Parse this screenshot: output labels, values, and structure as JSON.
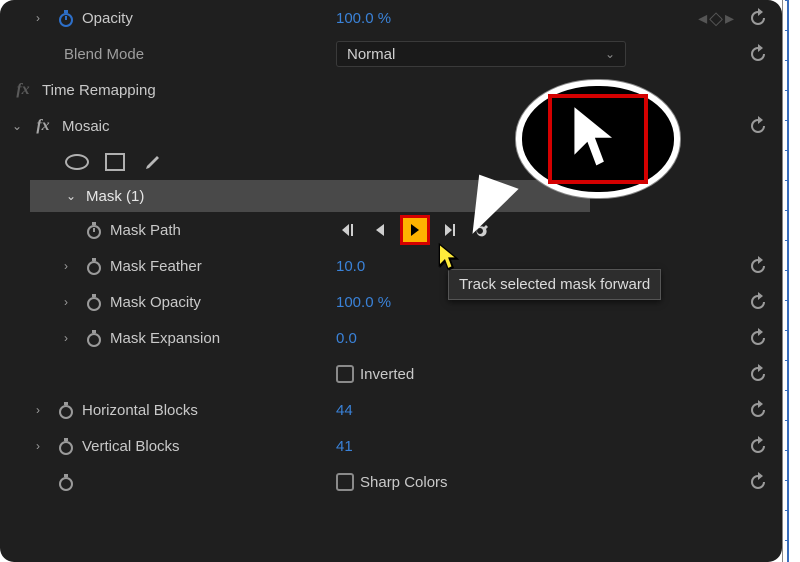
{
  "effect_controls": {
    "opacity": {
      "label": "Opacity",
      "value": "100.0 %"
    },
    "blend_mode": {
      "label": "Blend Mode",
      "value": "Normal"
    },
    "time_remapping": {
      "label": "Time Remapping"
    },
    "mosaic": {
      "label": "Mosaic",
      "mask": {
        "label": "Mask (1)",
        "path": {
          "label": "Mask Path"
        },
        "feather": {
          "label": "Mask Feather",
          "value": "10.0"
        },
        "opacity": {
          "label": "Mask Opacity",
          "value": "100.0 %"
        },
        "expansion": {
          "label": "Mask Expansion",
          "value": "0.0"
        },
        "inverted": {
          "label": "Inverted"
        }
      },
      "h_blocks": {
        "label": "Horizontal Blocks",
        "value": "44"
      },
      "v_blocks": {
        "label": "Vertical Blocks",
        "value": "41"
      },
      "sharp_colors": {
        "label": "Sharp Colors"
      }
    }
  },
  "tooltip": "Track selected mask forward"
}
